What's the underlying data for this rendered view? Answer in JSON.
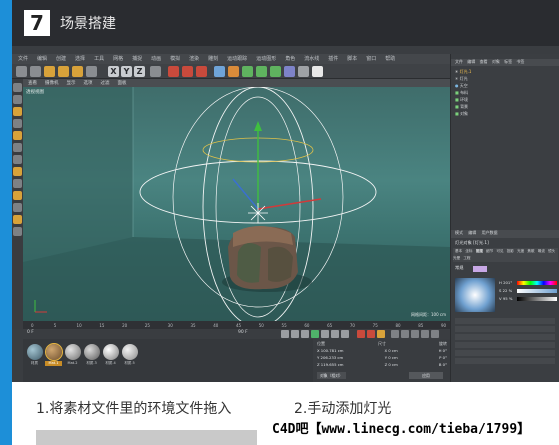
{
  "step": {
    "number": "7",
    "title": "场景搭建"
  },
  "menu": [
    "文件",
    "编辑",
    "创建",
    "选择",
    "工具",
    "网格",
    "捕捉",
    "动画",
    "模拟",
    "渲染",
    "雕刻",
    "运动跟踪",
    "运动图形",
    "角色",
    "流水线",
    "插件",
    "脚本",
    "窗口",
    "帮助"
  ],
  "viewport_menu": [
    "查看",
    "摄像机",
    "显示",
    "选项",
    "过滤",
    "面板"
  ],
  "viewport": {
    "name": "透视视图",
    "status": "网格间距：100 cm"
  },
  "toolbar_axes": [
    "X",
    "Y",
    "Z"
  ],
  "object_manager": {
    "tabs": [
      "文件",
      "编辑",
      "查看",
      "对象",
      "标签",
      "书签"
    ],
    "objects": [
      "灯光.1",
      "灯光",
      "天空",
      "布料",
      "环境",
      "背景",
      "对象"
    ]
  },
  "attributes": {
    "tabs": [
      "模式",
      "编辑",
      "用户数据"
    ],
    "title": "灯光对象 [灯光.1]",
    "subtabs": [
      "基本",
      "坐标",
      "常规",
      "细节",
      "可见",
      "投影",
      "光度",
      "焦散",
      "噪波",
      "镜头光晕",
      "工程"
    ],
    "section": "常规",
    "fields": [
      {
        "label": "H",
        "value": "201°"
      },
      {
        "label": "S",
        "value": "22 %"
      },
      {
        "label": "V",
        "value": "95 %"
      }
    ]
  },
  "materials": [
    "材质",
    "Mat.1",
    "Mat.2",
    "材质.3",
    "材质.4",
    "材质.5"
  ],
  "coords": {
    "headers": [
      "位置",
      "尺寸",
      "旋转"
    ],
    "rows": [
      [
        "X 100.781 cm",
        "X 0 cm",
        "H 0°"
      ],
      [
        "Y 206.233 cm",
        "Y 0 cm",
        "P 0°"
      ],
      [
        "Z 119.655 cm",
        "Z 0 cm",
        "B 0°"
      ]
    ],
    "mode": "对象（相对）",
    "apply": "应用"
  },
  "timeline": {
    "start": "0 F",
    "end": "90 F",
    "ticks": [
      "0",
      "5",
      "10",
      "15",
      "20",
      "25",
      "30",
      "35",
      "40",
      "45",
      "50",
      "55",
      "60",
      "65",
      "70",
      "75",
      "80",
      "85",
      "90"
    ]
  },
  "captions": [
    "1.将素材文件里的环境文件拖入",
    "2.手动添加灯光"
  ],
  "watermark": "C4D吧【www.linecg.com/tieba/1799】",
  "colors": {
    "accent_blue": "#1d8fd8",
    "header_dark": "#2a2c30",
    "viewport_teal": "#4a8481"
  }
}
